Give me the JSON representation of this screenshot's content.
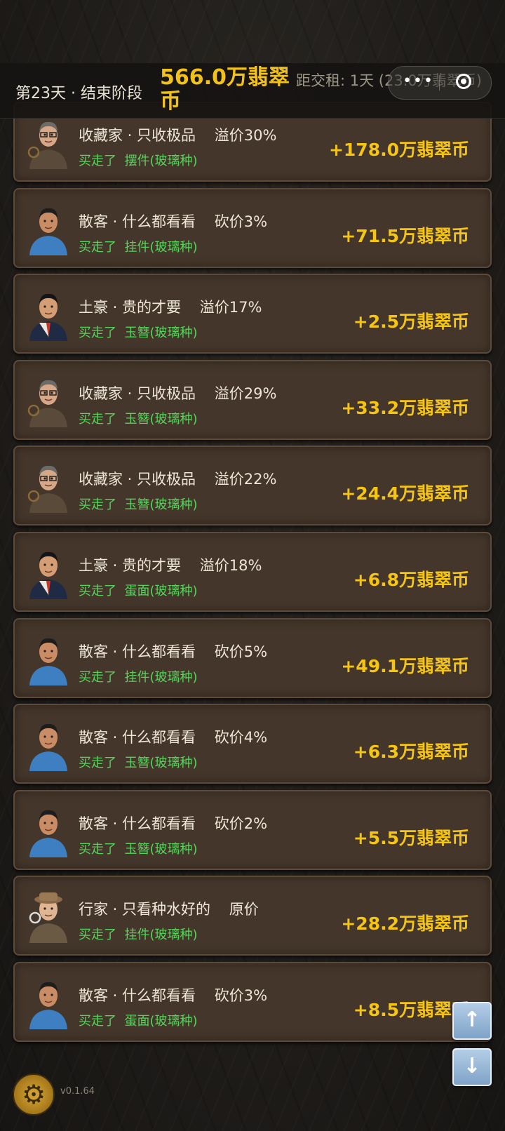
{
  "header": {
    "day_phase": "第23天 · 结束阶段",
    "money": "566.0万翡翠币",
    "rent_notice": "距交租: 1天 (23.0万翡翠币)",
    "menu_label": "•••"
  },
  "transactions": [
    {
      "buyer": "收藏家 · 只收极品",
      "price_note": "溢价30%",
      "action": "买走了",
      "item": "摆件(玻璃种)",
      "amount": "+178.0万翡翠币",
      "avatar": "collector-avatar"
    },
    {
      "buyer": "散客 · 什么都看看",
      "price_note": "砍价3%",
      "action": "买走了",
      "item": "挂件(玻璃种)",
      "amount": "+71.5万翡翠币",
      "avatar": "casual-customer-avatar"
    },
    {
      "buyer": "土豪 · 贵的才要",
      "price_note": "溢价17%",
      "action": "买走了",
      "item": "玉簪(玻璃种)",
      "amount": "+2.5万翡翠币",
      "avatar": "tycoon-avatar"
    },
    {
      "buyer": "收藏家 · 只收极品",
      "price_note": "溢价29%",
      "action": "买走了",
      "item": "玉簪(玻璃种)",
      "amount": "+33.2万翡翠币",
      "avatar": "collector-avatar"
    },
    {
      "buyer": "收藏家 · 只收极品",
      "price_note": "溢价22%",
      "action": "买走了",
      "item": "玉簪(玻璃种)",
      "amount": "+24.4万翡翠币",
      "avatar": "collector-avatar"
    },
    {
      "buyer": "土豪 · 贵的才要",
      "price_note": "溢价18%",
      "action": "买走了",
      "item": "蛋面(玻璃种)",
      "amount": "+6.8万翡翠币",
      "avatar": "tycoon-avatar"
    },
    {
      "buyer": "散客 · 什么都看看",
      "price_note": "砍价5%",
      "action": "买走了",
      "item": "挂件(玻璃种)",
      "amount": "+49.1万翡翠币",
      "avatar": "casual-customer-avatar"
    },
    {
      "buyer": "散客 · 什么都看看",
      "price_note": "砍价4%",
      "action": "买走了",
      "item": "玉簪(玻璃种)",
      "amount": "+6.3万翡翠币",
      "avatar": "casual-customer-avatar"
    },
    {
      "buyer": "散客 · 什么都看看",
      "price_note": "砍价2%",
      "action": "买走了",
      "item": "玉簪(玻璃种)",
      "amount": "+5.5万翡翠币",
      "avatar": "casual-customer-avatar"
    },
    {
      "buyer": "行家 · 只看种水好的",
      "price_note": "原价",
      "action": "买走了",
      "item": "挂件(玻璃种)",
      "amount": "+28.2万翡翠币",
      "avatar": "expert-avatar"
    },
    {
      "buyer": "散客 · 什么都看看",
      "price_note": "砍价3%",
      "action": "买走了",
      "item": "蛋面(玻璃种)",
      "amount": "+8.5万翡翠币",
      "avatar": "casual-customer-avatar"
    }
  ],
  "footer": {
    "version": "v0.1.64",
    "scroll_up_icon": "arrow-up-icon",
    "scroll_down_icon": "arrow-down-icon",
    "settings_icon": "gear-icon"
  }
}
